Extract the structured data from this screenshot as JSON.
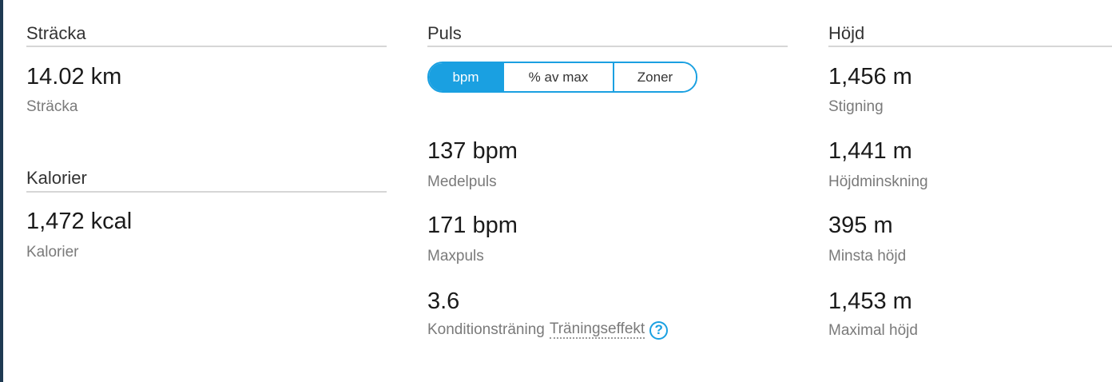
{
  "distance": {
    "title": "Sträcka",
    "value": "14.02 km",
    "label": "Sträcka"
  },
  "calories": {
    "title": "Kalorier",
    "value": "1,472 kcal",
    "label": "Kalorier"
  },
  "heart_rate": {
    "title": "Puls",
    "tabs": [
      {
        "label": "bpm",
        "active": true
      },
      {
        "label": "% av max",
        "active": false
      },
      {
        "label": "Zoner",
        "active": false
      }
    ],
    "stats": [
      {
        "value": "137 bpm",
        "label": "Medelpuls"
      },
      {
        "value": "171 bpm",
        "label": "Maxpuls"
      }
    ],
    "training_effect": {
      "value": "3.6",
      "label": "Konditionsträning",
      "link": "Träningseffekt",
      "help_icon": "question-circle-icon"
    }
  },
  "elevation": {
    "title": "Höjd",
    "stats": [
      {
        "value": "1,456 m",
        "label": "Stigning"
      },
      {
        "value": "1,441 m",
        "label": "Höjdminskning"
      },
      {
        "value": "395 m",
        "label": "Minsta höjd"
      },
      {
        "value": "1,453 m",
        "label": "Maximal höjd"
      }
    ]
  },
  "colors": {
    "accent": "#1aa0e1",
    "left_edge": "#1f3a52",
    "label": "#7a7a7a",
    "rule": "#d6d6d6"
  }
}
